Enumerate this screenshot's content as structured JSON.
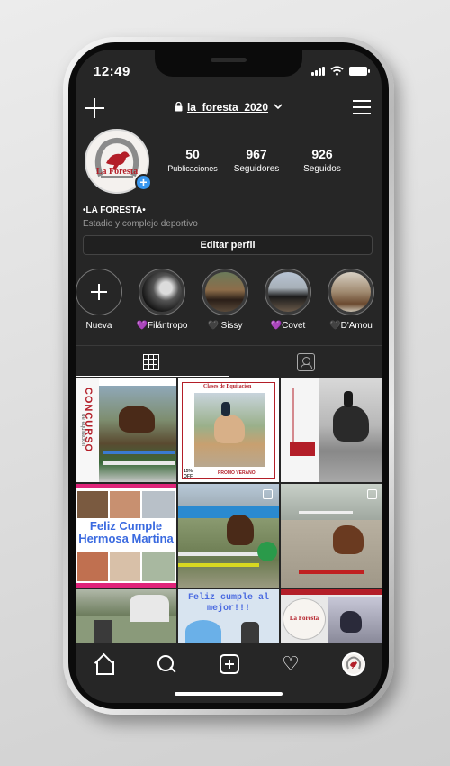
{
  "status_bar": {
    "time": "12:49"
  },
  "header": {
    "username": "la_foresta_2020"
  },
  "profile": {
    "avatar_logo_text": "La Foresta",
    "stats": [
      {
        "value": "50",
        "label": "Publicaciones"
      },
      {
        "value": "967",
        "label": "Seguidores"
      },
      {
        "value": "926",
        "label": "Seguidos"
      }
    ],
    "name": "•LA FORESTA•",
    "bio": "Estadio y complejo deportivo",
    "edit_label": "Editar perfil"
  },
  "highlights": [
    {
      "label": "Nueva"
    },
    {
      "label": "💜Filántropo"
    },
    {
      "label": "🖤 Sissy"
    },
    {
      "label": "💜Covet"
    },
    {
      "label": "🖤D'Amou"
    }
  ],
  "posts": {
    "p1_text": "CONCURSO",
    "p1_sub": "de equitación",
    "p2_text": "Clases de Equitación",
    "p2_badge": "15% OFF",
    "p2_promo": "PROMO VERANO",
    "p4_text": "Feliz Cumple Hermosa Martina",
    "p8_text": "Feliz cumple al mejor!!!",
    "p9_logo": "La Foresta"
  },
  "icons": {
    "new_post": "plus-icon",
    "lock": "lock-icon",
    "dropdown": "chevron-down-icon",
    "menu": "hamburger-icon",
    "grid": "grid-icon",
    "tagged": "tagged-icon",
    "home": "home-icon",
    "search": "search-icon",
    "add": "add-square-icon",
    "activity": "heart-icon"
  },
  "colors": {
    "background": "#262626",
    "accent": "#3897f0",
    "brand_red": "#b31e28"
  }
}
